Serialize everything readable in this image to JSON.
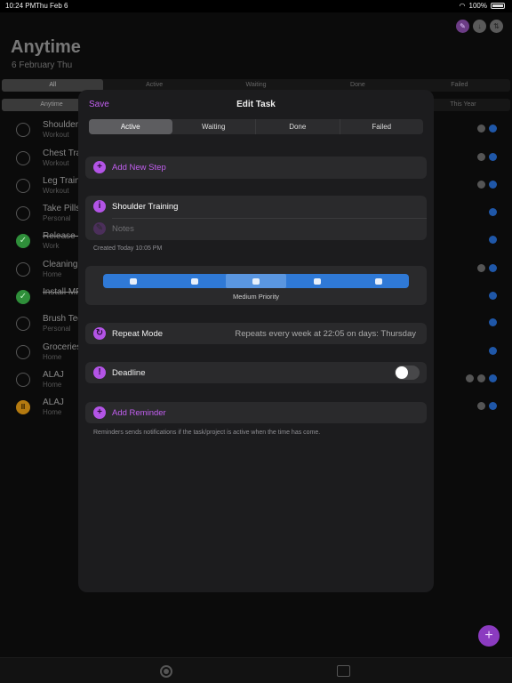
{
  "status": {
    "time": "10:24 PM",
    "date": "Thu Feb 6",
    "battery": "100%"
  },
  "background": {
    "title": "Anytime",
    "date": "6 February Thu",
    "filters": [
      "All",
      "Active",
      "Waiting",
      "Done",
      "Failed"
    ],
    "ranges": {
      "selected": "Anytime",
      "this_year": "This Year"
    },
    "tasks": [
      {
        "name": "Shoulder",
        "category": "Workout",
        "state": "open"
      },
      {
        "name": "Chest Tra",
        "category": "Workout",
        "state": "open"
      },
      {
        "name": "Leg Traini",
        "category": "Workout",
        "state": "open"
      },
      {
        "name": "Take Pills",
        "category": "Personal",
        "state": "open"
      },
      {
        "name": "Release M",
        "category": "Work",
        "state": "done"
      },
      {
        "name": "Cleaning",
        "category": "Home",
        "state": "open"
      },
      {
        "name": "Install MP",
        "category": "",
        "state": "done"
      },
      {
        "name": "Brush Tee",
        "category": "Personal",
        "state": "open"
      },
      {
        "name": "Groceries",
        "category": "Home",
        "state": "open"
      },
      {
        "name": "ALAJ",
        "category": "Home",
        "state": "open"
      },
      {
        "name": "ALAJ",
        "category": "Home",
        "state": "paused"
      }
    ],
    "fab_icon": "plus-icon"
  },
  "modal": {
    "save": "Save",
    "title": "Edit Task",
    "segments": [
      "Active",
      "Waiting",
      "Done",
      "Failed"
    ],
    "selected_segment": "Active",
    "add_step": "Add New Step",
    "task_name": "Shoulder Training",
    "notes_placeholder": "Notes",
    "created": "Created Today 10:05 PM",
    "priority": {
      "levels": 5,
      "selected_index": 2,
      "label": "Medium Priority"
    },
    "repeat": {
      "label": "Repeat Mode",
      "detail": "Repeats every week at 22:05 on days: Thursday"
    },
    "deadline": {
      "label": "Deadline",
      "enabled": false
    },
    "add_reminder": "Add Reminder",
    "reminder_note": "Reminders sends notifications if the task/project is active when the time has come."
  },
  "colors": {
    "accent": "#c25ff0",
    "priority": "#2f79d6",
    "done": "#2f8f3a",
    "paused": "#b47a10"
  }
}
